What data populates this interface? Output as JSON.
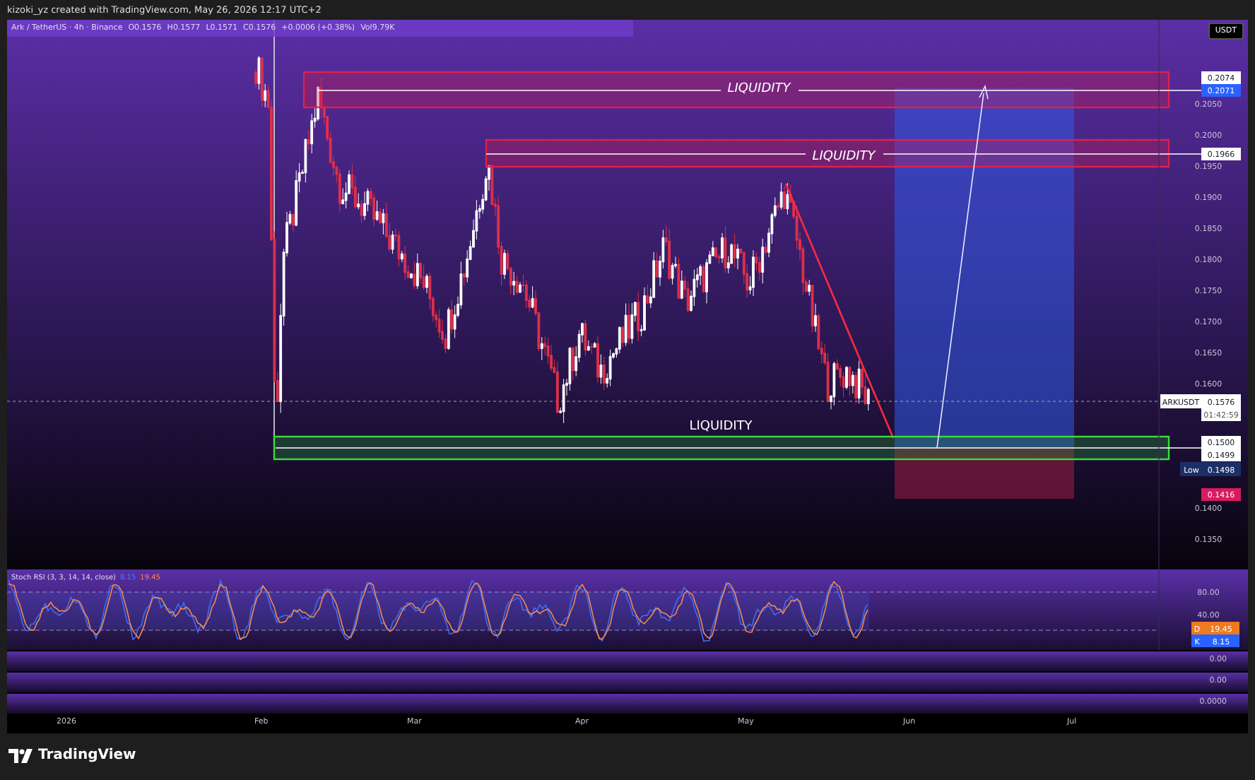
{
  "attribution": "kizoki_yz created with TradingView.com, May 26, 2026 12:17 UTC+2",
  "legend": {
    "symbol": "Ark / TetherUS · 4h · Binance",
    "ohlc": [
      {
        "label": "O",
        "value": "0.1576"
      },
      {
        "label": "H",
        "value": "0.1577"
      },
      {
        "label": "L",
        "value": "0.1571"
      },
      {
        "label": "C",
        "value": "0.1576"
      }
    ],
    "change": "+0.0006 (+0.38%)",
    "volume_label": "Vol",
    "volume": "9.79K"
  },
  "currency": "USDT",
  "zones": [
    {
      "label": "LIQUIDITY",
      "kind": "red"
    },
    {
      "label": "LIQUIDITY",
      "kind": "red"
    },
    {
      "label": "LIQUIDITY",
      "kind": "green"
    }
  ],
  "price_ticks": [
    "0.2050",
    "0.2000",
    "0.1950",
    "0.1900",
    "0.1850",
    "0.1800",
    "0.1750",
    "0.1700",
    "0.1650",
    "0.1600",
    "0.1400",
    "0.1350"
  ],
  "price_tags": [
    {
      "text": "0.2074",
      "kind": "plain"
    },
    {
      "text": "0.2071",
      "kind": "blue"
    },
    {
      "text": "0.1966",
      "kind": "plain"
    },
    {
      "text": "0.1500",
      "kind": "plain"
    },
    {
      "text": "0.1499",
      "kind": "plain"
    },
    {
      "text": "0.1416",
      "kind": "red"
    }
  ],
  "symbol_tag": {
    "symbol": "ARKUSDT",
    "price": "0.1576",
    "countdown": "01:42:59"
  },
  "low_tag": {
    "label": "Low",
    "price": "0.1498"
  },
  "stoch": {
    "title": "Stoch RSI (3, 3, 14, 14, close)",
    "legend_k": "8.15",
    "legend_d": "19.45",
    "k": "8.15",
    "d": "19.45",
    "ticks": [
      "80.00",
      "40.00"
    ],
    "d_label": "D",
    "k_label": "K"
  },
  "panes": [
    "0.00",
    "0.00",
    "0.0000"
  ],
  "time_axis": [
    "2026",
    "Feb",
    "Mar",
    "Apr",
    "May",
    "Jun",
    "Jul"
  ],
  "brand": "TradingView"
}
